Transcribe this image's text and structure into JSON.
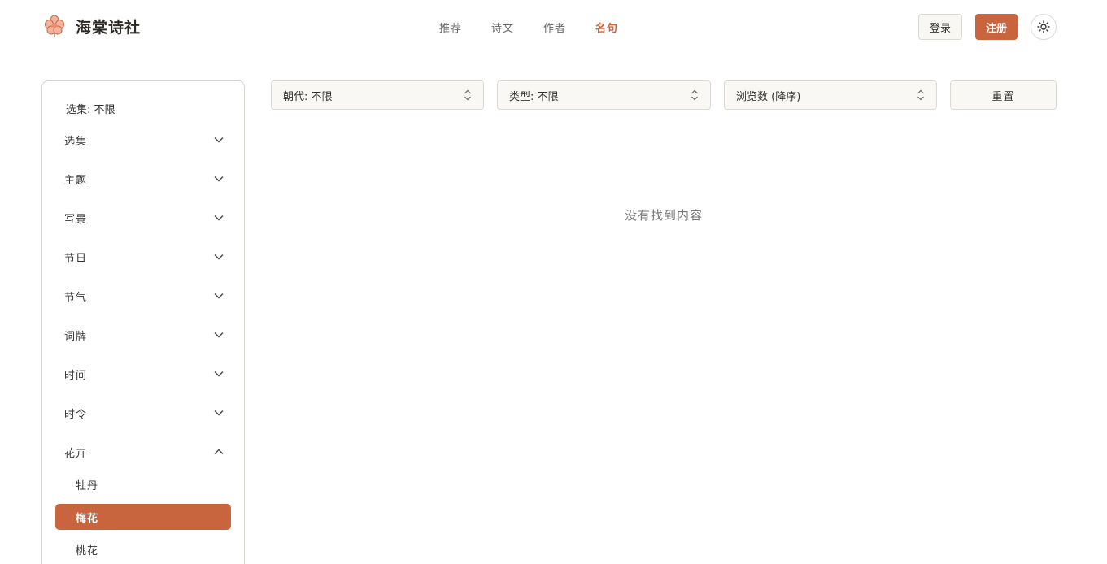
{
  "brand": {
    "name": "海棠诗社",
    "logo_icon": "begonia-flower-icon",
    "accent": "#c8653f"
  },
  "nav": {
    "items": [
      "推荐",
      "诗文",
      "作者",
      "名句"
    ],
    "active_index": 3
  },
  "header": {
    "login_label": "登录",
    "register_label": "注册",
    "theme_icon": "sun-icon"
  },
  "sidebar": {
    "summary": "选集: 不限",
    "categories": [
      {
        "label": "选集",
        "expanded": false
      },
      {
        "label": "主题",
        "expanded": false
      },
      {
        "label": "写景",
        "expanded": false
      },
      {
        "label": "节日",
        "expanded": false
      },
      {
        "label": "节气",
        "expanded": false
      },
      {
        "label": "词牌",
        "expanded": false
      },
      {
        "label": "时间",
        "expanded": false
      },
      {
        "label": "时令",
        "expanded": false
      },
      {
        "label": "花卉",
        "expanded": true
      }
    ],
    "flower_items": [
      {
        "label": "牡丹",
        "active": false
      },
      {
        "label": "梅花",
        "active": true
      },
      {
        "label": "桃花",
        "active": false
      }
    ]
  },
  "filters": {
    "dynasty": "朝代: 不限",
    "type": "类型: 不限",
    "sort": "浏览数 (降序)",
    "reset_label": "重置"
  },
  "main": {
    "empty_message": "没有找到内容"
  }
}
